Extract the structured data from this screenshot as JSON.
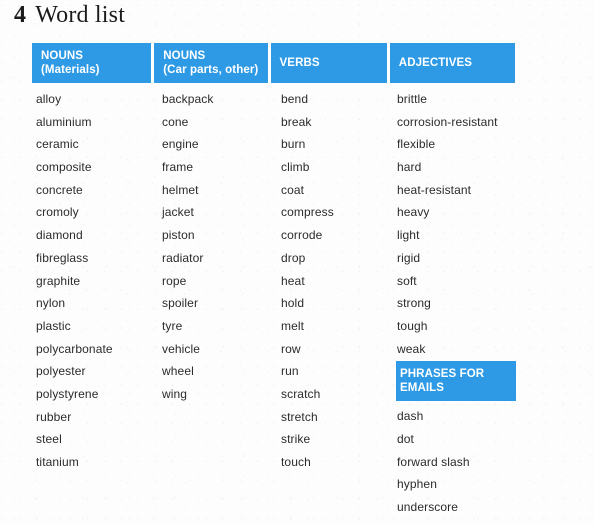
{
  "title": {
    "number": "4",
    "text": "Word list"
  },
  "colors": {
    "header_blue": "#2e9ae6",
    "header_text": "#ffffff",
    "body_text": "#2b2b2b",
    "page_background": "#fdfdfd"
  },
  "table": {
    "headers": [
      {
        "line1": "NOUNS",
        "line2": "(Materials)"
      },
      {
        "line1": "NOUNS",
        "line2": "(Car parts, other)"
      },
      {
        "line1": "VERBS",
        "line2": ""
      },
      {
        "line1": "ADJECTIVES",
        "line2": ""
      }
    ],
    "columns": [
      {
        "key": "nouns_materials",
        "words": [
          "alloy",
          "aluminium",
          "ceramic",
          "composite",
          "concrete",
          "cromoly",
          "diamond",
          "fibreglass",
          "graphite",
          "nylon",
          "plastic",
          "polycarbonate",
          "polyester",
          "polystyrene",
          "rubber",
          "steel",
          "titanium"
        ]
      },
      {
        "key": "nouns_car_parts_other",
        "words": [
          "backpack",
          "cone",
          "engine",
          "frame",
          "helmet",
          "jacket",
          "piston",
          "radiator",
          "rope",
          "spoiler",
          "tyre",
          "vehicle",
          "wheel",
          "wing"
        ]
      },
      {
        "key": "verbs",
        "words": [
          "bend",
          "break",
          "burn",
          "climb",
          "coat",
          "compress",
          "corrode",
          "drop",
          "heat",
          "hold",
          "melt",
          "row",
          "run",
          "scratch",
          "stretch",
          "strike",
          "touch"
        ]
      },
      {
        "key": "adjectives",
        "words": [
          "brittle",
          "corrosion-resistant",
          "flexible",
          "hard",
          "heat-resistant",
          "heavy",
          "light",
          "rigid",
          "soft",
          "strong",
          "tough",
          "weak"
        ],
        "subsection": {
          "heading_line1": "PHRASES FOR",
          "heading_line2": "EMAILS",
          "words": [
            "dash",
            "dot",
            "forward slash",
            "hyphen",
            "underscore"
          ]
        }
      }
    ]
  }
}
